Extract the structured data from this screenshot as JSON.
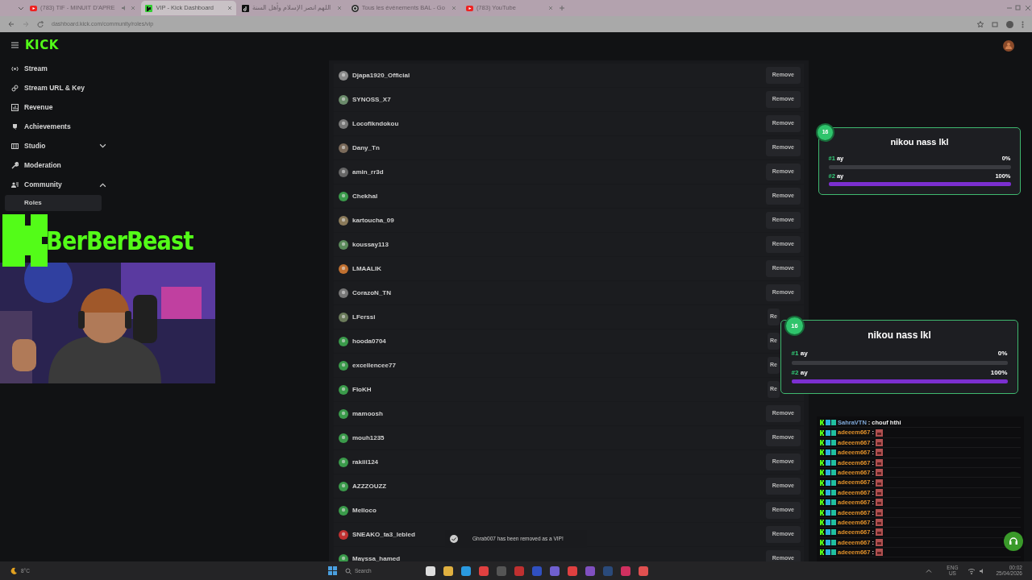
{
  "browser": {
    "tabs": [
      {
        "title": "(783) TIF - MINUIT D'APRE",
        "audio": true,
        "selected": false
      },
      {
        "title": "VIP - Kick Dashboard",
        "audio": false,
        "selected": true
      },
      {
        "title": "اللهم انصر الإسلام وأهل السنة",
        "audio": false,
        "selected": false
      },
      {
        "title": "Tous les événements BAL - Go",
        "audio": false,
        "selected": false
      },
      {
        "title": "(783) YouTube",
        "audio": false,
        "selected": false
      }
    ],
    "url": "dashboard.kick.com/community/roles/vip"
  },
  "brand": "KICK",
  "sidebar": {
    "items": [
      {
        "label": "Stream"
      },
      {
        "label": "Stream URL & Key"
      },
      {
        "label": "Revenue"
      },
      {
        "label": "Achievements"
      },
      {
        "label": "Studio",
        "expanded": false
      },
      {
        "label": "Moderation"
      },
      {
        "label": "Community",
        "expanded": true,
        "children": [
          {
            "label": "Roles",
            "selected": true
          }
        ]
      }
    ]
  },
  "vips": [
    {
      "name": "Djapa1920_Official",
      "remove": "Remove"
    },
    {
      "name": "SYNOSS_X7",
      "remove": "Remove"
    },
    {
      "name": "Locofikndokou",
      "remove": "Remove"
    },
    {
      "name": "Dany_Tn",
      "remove": "Remove"
    },
    {
      "name": "amin_rr3d",
      "remove": "Remove"
    },
    {
      "name": "Chekhal",
      "remove": "Remove"
    },
    {
      "name": "kartoucha_09",
      "remove": "Remove"
    },
    {
      "name": "koussay113",
      "remove": "Remove"
    },
    {
      "name": "LMAALIK",
      "remove": "Remove"
    },
    {
      "name": "CorazoN_TN",
      "remove": "Remove"
    },
    {
      "name": "LFerssi",
      "remove": "Re"
    },
    {
      "name": "hooda0704",
      "remove": "Re"
    },
    {
      "name": "excellencee77",
      "remove": "Re"
    },
    {
      "name": "FloKH",
      "remove": "Re"
    },
    {
      "name": "mamoosh",
      "remove": "Remove"
    },
    {
      "name": "mouh1235",
      "remove": "Remove"
    },
    {
      "name": "rakiii124",
      "remove": "Remove"
    },
    {
      "name": "AZZZOUZZ",
      "remove": "Remove"
    },
    {
      "name": "Melloco",
      "remove": "Remove"
    },
    {
      "name": "SNEAKO_ta3_lebled",
      "remove": "Remove"
    },
    {
      "name": "Mayssa_hamed",
      "remove": "Remove"
    }
  ],
  "toast": "Ghrab007 has been removed as a VIP!",
  "stream_overlay": {
    "channel_name": "BerBerBeast",
    "polls": [
      {
        "count": "16",
        "question": "nikou nass lkl",
        "options": [
          {
            "number": "#1",
            "label": "ay",
            "percent": "0%",
            "level": 0
          },
          {
            "number": "#2",
            "label": "ay",
            "percent": "100%",
            "level": 1
          }
        ]
      },
      {
        "count": "16",
        "question": "nikou nass lkl",
        "options": [
          {
            "number": "#1",
            "label": "ay",
            "percent": "0%",
            "level": 0
          },
          {
            "number": "#2",
            "label": "ay",
            "percent": "100%",
            "level": 1
          }
        ]
      }
    ],
    "chat": [
      {
        "user": "SahraVTN",
        "color": "#7fa8d8",
        "separator": ":",
        "message": "chouf hthi",
        "kind": "text"
      },
      {
        "user": "adeeem667",
        "color": "#e0902a",
        "separator": ":",
        "kind": "emote"
      },
      {
        "user": "adeeem667",
        "color": "#e0902a",
        "separator": ":",
        "kind": "emote"
      },
      {
        "user": "adeeem667",
        "color": "#e0902a",
        "separator": ":",
        "kind": "emote"
      },
      {
        "user": "adeeem667",
        "color": "#e0902a",
        "separator": ":",
        "kind": "emote"
      },
      {
        "user": "adeeem667",
        "color": "#e0902a",
        "separator": ":",
        "kind": "emote"
      },
      {
        "user": "adeeem667",
        "color": "#e0902a",
        "separator": ":",
        "kind": "emote"
      },
      {
        "user": "adeeem667",
        "color": "#e0902a",
        "separator": ":",
        "kind": "emote"
      },
      {
        "user": "adeeem667",
        "color": "#e0902a",
        "separator": ":",
        "kind": "emote"
      },
      {
        "user": "adeeem667",
        "color": "#e0902a",
        "separator": ":",
        "kind": "emote"
      },
      {
        "user": "adeeem667",
        "color": "#e0902a",
        "separator": ":",
        "kind": "emote"
      },
      {
        "user": "adeeem667",
        "color": "#e0902a",
        "separator": ":",
        "kind": "emote"
      },
      {
        "user": "adeeem667",
        "color": "#e0902a",
        "separator": ":",
        "kind": "emote"
      },
      {
        "user": "adeeem667",
        "color": "#e0902a",
        "separator": ":",
        "kind": "emote"
      }
    ]
  },
  "taskbar": {
    "weather": "8°C",
    "search_placeholder": "Search",
    "language": "ENG",
    "region": "US",
    "time": "00:02",
    "date": "25/04/2026"
  }
}
